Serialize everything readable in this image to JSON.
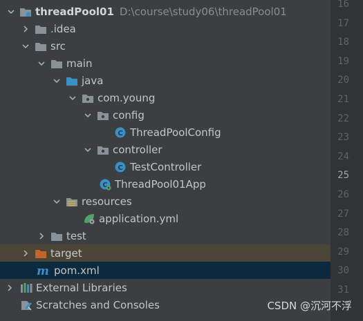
{
  "project": {
    "name": "threadPool01",
    "path": "D:\\course\\study06\\threadPool01"
  },
  "tree": {
    "idea": ".idea",
    "src": "src",
    "main": "main",
    "java": "java",
    "package": "com.young",
    "config": "config",
    "config_class": "ThreadPoolConfig",
    "controller": "controller",
    "controller_class": "TestController",
    "app_class": "ThreadPool01App",
    "resources": "resources",
    "application_yml": "application.yml",
    "test": "test",
    "target": "target",
    "pom": "pom.xml",
    "external_libraries": "External Libraries",
    "scratches": "Scratches and Consoles"
  },
  "gutter": {
    "line_numbers": [
      "16",
      "17",
      "18",
      "19",
      "20",
      "21",
      "22",
      "23",
      "24",
      "25",
      "26",
      "27",
      "28",
      "29",
      "30",
      "31"
    ],
    "current_line": "25"
  },
  "watermark": "CSDN @沉河不浮",
  "colors": {
    "background": "#3c3f41",
    "gutter": "#313335",
    "selected_row": "#0d293e",
    "excluded_row": "#4b4537",
    "folder": "#8a9299",
    "source_folder": "#3a8fc4",
    "excluded_folder": "#c2652a",
    "class_icon": "#3a8fc4"
  }
}
